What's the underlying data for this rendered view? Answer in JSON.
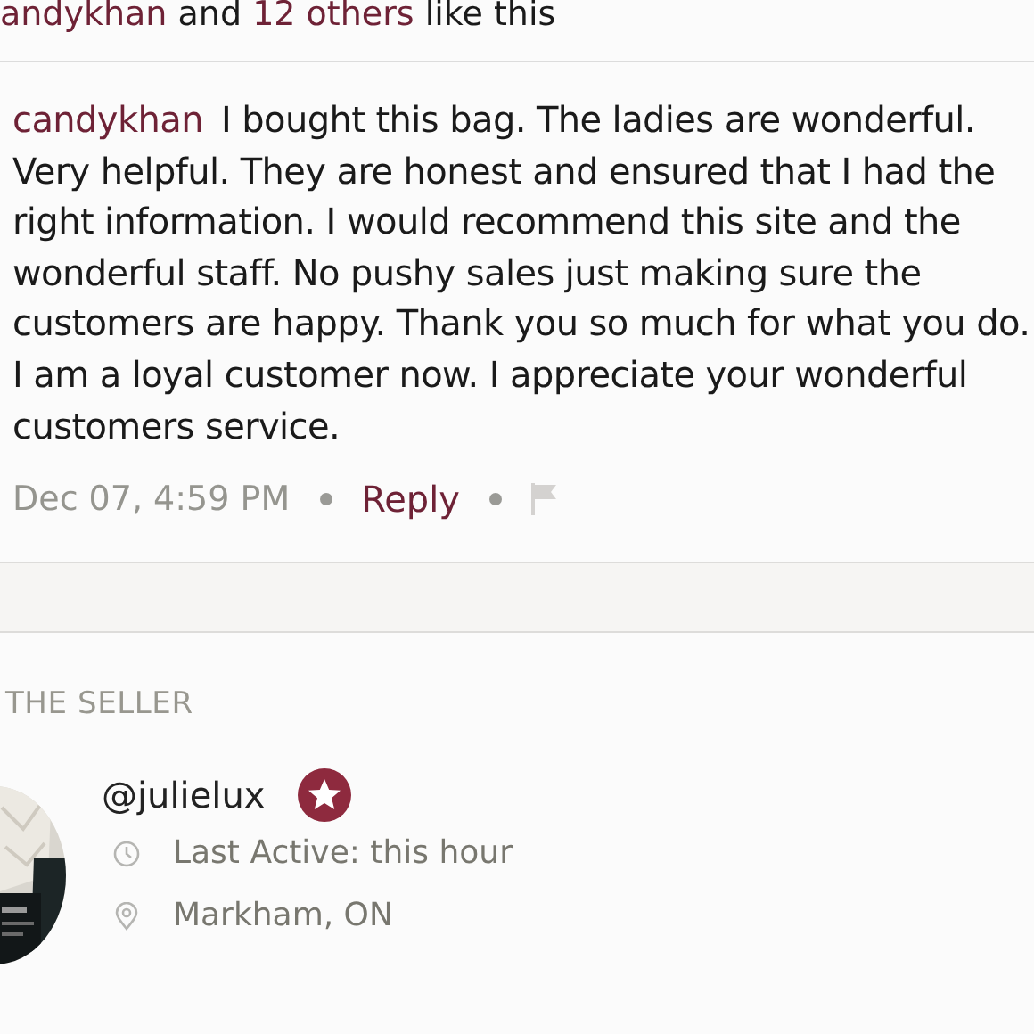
{
  "likes": {
    "first_user": "andykhan",
    "joiner": "and",
    "others": "12 others",
    "suffix": "like this"
  },
  "comment": {
    "author": "candykhan",
    "text": "I bought this bag. The ladies are wonderful. Very helpful. They are honest and ensured that I had the right information. I would recommend this site and the wonderful staff. No pushy sales just making sure the customers are happy. Thank you so much for what you do. I am a loyal customer now. I appreciate your wonderful customers service.",
    "date": "Dec 07, 4:59 PM",
    "reply": "Reply"
  },
  "seller": {
    "heading": "THE SELLER",
    "username": "@julielux",
    "badge": true,
    "details": [
      {
        "kind": "clock",
        "text": "Last Active: this hour"
      },
      {
        "kind": "pin",
        "text": "Markham, ON"
      }
    ]
  }
}
